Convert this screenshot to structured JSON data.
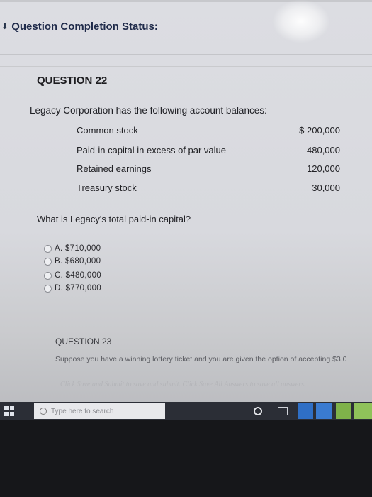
{
  "status": {
    "toggle_icon": "chevron-down-icon",
    "title": "Question Completion Status:"
  },
  "question22": {
    "label": "QUESTION 22",
    "intro": "Legacy Corporation has the following account balances:",
    "accounts": [
      {
        "name": "Common stock",
        "value": "$ 200,000"
      },
      {
        "name": "Paid-in capital in excess of par value",
        "value": "480,000"
      },
      {
        "name": "Retained earnings",
        "value": "120,000"
      },
      {
        "name": "Treasury stock",
        "value": "30,000"
      }
    ],
    "question": "What is Legacy's total paid-in capital?",
    "choices": [
      {
        "label": "A. $710,000"
      },
      {
        "label": "B. $680,000"
      },
      {
        "label": "C. $480,000"
      },
      {
        "label": "D. $770,000"
      }
    ]
  },
  "question23": {
    "label": "QUESTION 23",
    "text": "Suppose you have a winning lottery ticket and you are given the option of accepting $3.0"
  },
  "footer_hint": "Click Save and Submit to save and submit. Click Save All Answers to save all answers.",
  "taskbar": {
    "search_placeholder": "Type here to search"
  }
}
